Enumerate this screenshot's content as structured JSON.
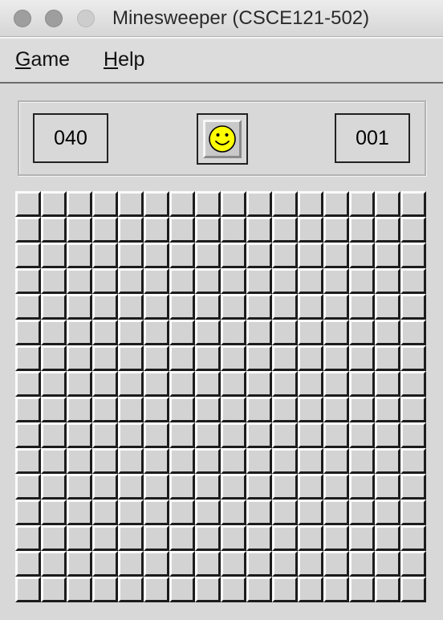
{
  "window": {
    "title": "Minesweeper (CSCE121-502)"
  },
  "menu": {
    "game_mnemonic": "G",
    "game_rest": "ame",
    "help_mnemonic": "H",
    "help_rest": "elp"
  },
  "status": {
    "mines_remaining": "040",
    "timer": "001",
    "face": "smiley-face-icon",
    "face_color": "#ffff00"
  },
  "board": {
    "rows": 16,
    "cols": 16,
    "state": "all-covered"
  }
}
